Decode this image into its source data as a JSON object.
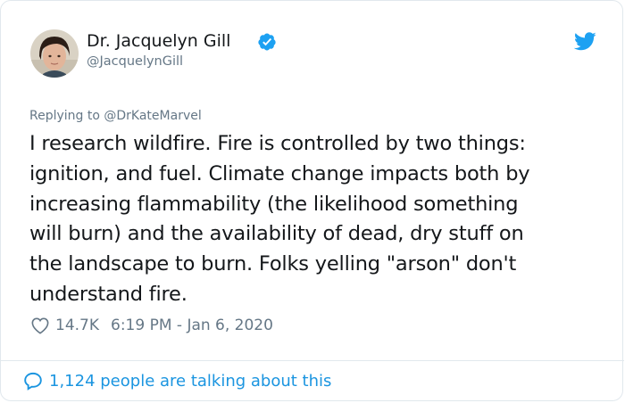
{
  "author": {
    "name": "Dr. Jacquelyn Gill",
    "handle": "@JacquelynGill",
    "verified": true,
    "avatar": "avatar-photo"
  },
  "reply": {
    "text": "Replying to @DrKateMarvel"
  },
  "tweet": {
    "text": "I research wildfire. Fire is controlled by two things:\nignition, and fuel. Climate change impacts both by\nincreasing flammability (the likelihood something\nwill burn) and the availability of dead, dry stuff on\nthe landscape to burn. Folks yelling \"arson\" don't\nunderstand fire."
  },
  "meta": {
    "likes": "14.7K",
    "timestamp": "6:19 PM - Jan 6, 2020"
  },
  "footer": {
    "talking": "1,124 people are talking about this"
  },
  "icons": {
    "brand": "twitter-bird-icon",
    "verified": "verified-badge-icon",
    "like": "heart-icon",
    "reply": "speech-bubble-icon"
  },
  "colors": {
    "brand_blue": "#1da1f2",
    "link_blue": "#1b95e0",
    "text": "#14171a",
    "muted": "#657786",
    "border": "#e1e8ed"
  }
}
